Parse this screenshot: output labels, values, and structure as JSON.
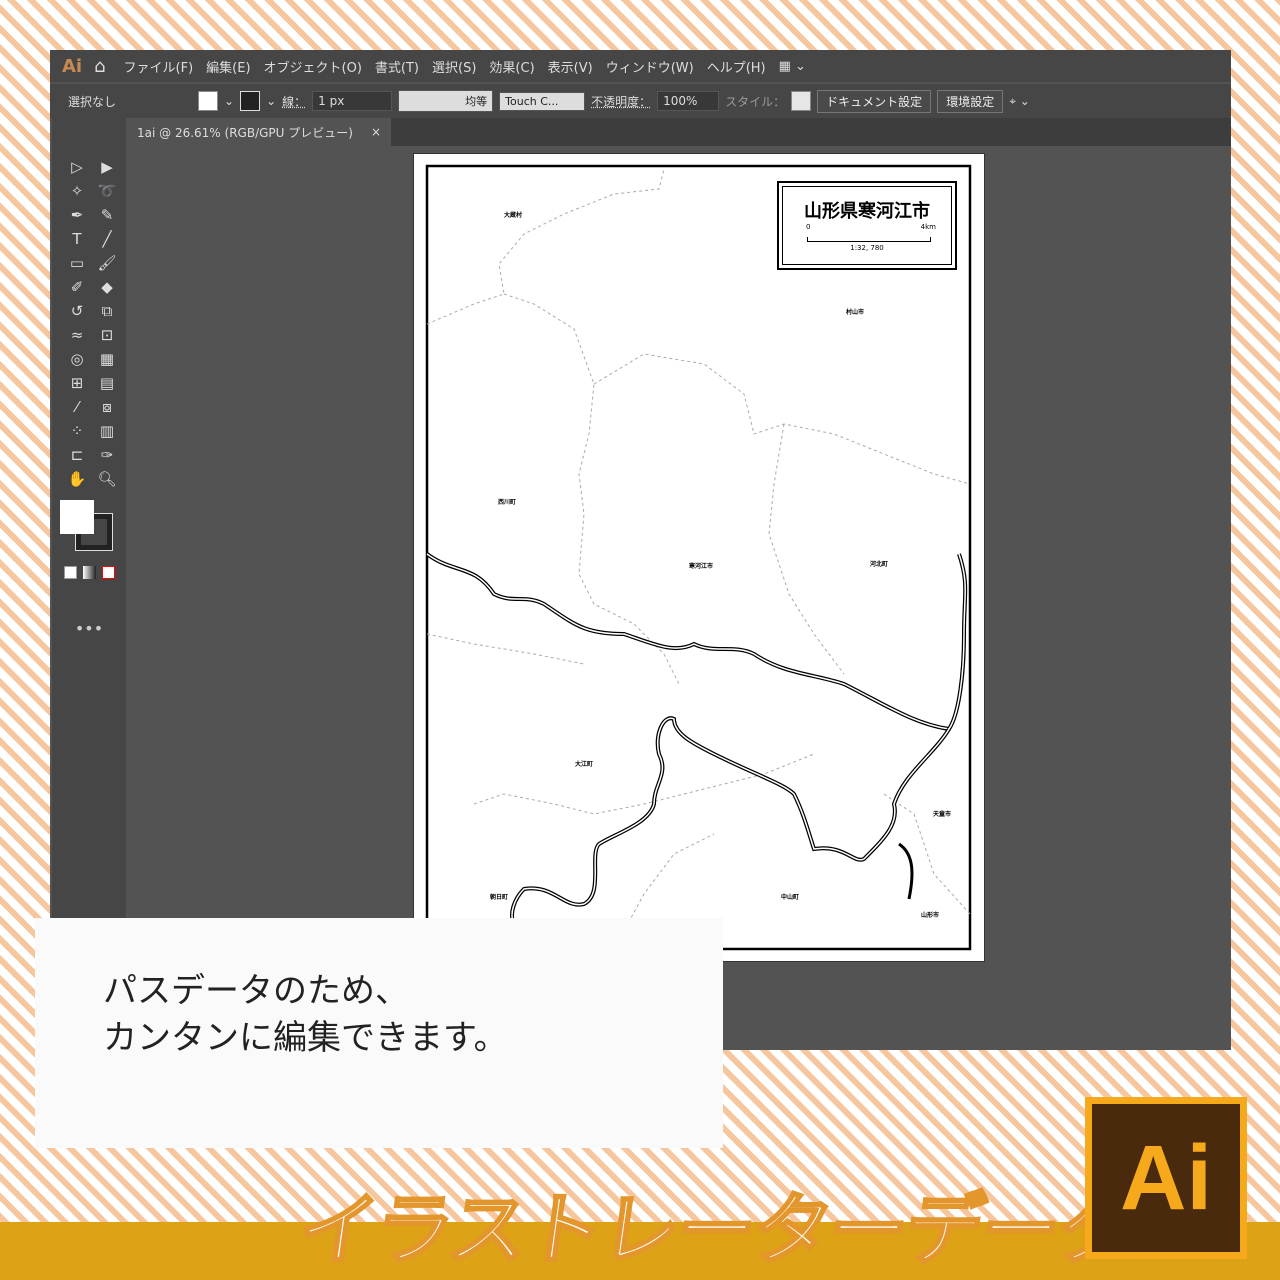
{
  "app": {
    "logo": "Ai",
    "menu": [
      "ファイル(F)",
      "編集(E)",
      "オブジェクト(O)",
      "書式(T)",
      "選択(S)",
      "効果(C)",
      "表示(V)",
      "ウィンドウ(W)",
      "ヘルプ(H)"
    ]
  },
  "control": {
    "selection": "選択なし",
    "stroke_label": "線：",
    "stroke_value": "1 px",
    "profile": "均等",
    "brush": "Touch C...",
    "opacity_label": "不透明度：",
    "opacity": "100%",
    "style_label": "スタイル：",
    "doc_settings": "ドキュメント設定",
    "preferences": "環境設定"
  },
  "tab": {
    "title": "1ai @ 26.61% (RGB/GPU プレビュー)",
    "close": "×"
  },
  "map": {
    "title": "山形県寒河江市",
    "scale_start": "0",
    "scale_end": "4km",
    "scale": "1:32, 780",
    "labels": [
      "大蔵村",
      "村山市",
      "西川町",
      "寒河江市",
      "河北町",
      "大江町",
      "天童市",
      "朝日町",
      "中山町",
      "山形市"
    ]
  },
  "caption": {
    "line1": "パスデータのため、",
    "line2": "カンタンに編集できます。"
  },
  "banner": {
    "title": "イラストレーターデータ",
    "logo": "Ai"
  },
  "colors": {
    "band": "#dea216",
    "logo_bg": "#4a2a0c",
    "logo_fg": "#f6a91b"
  }
}
